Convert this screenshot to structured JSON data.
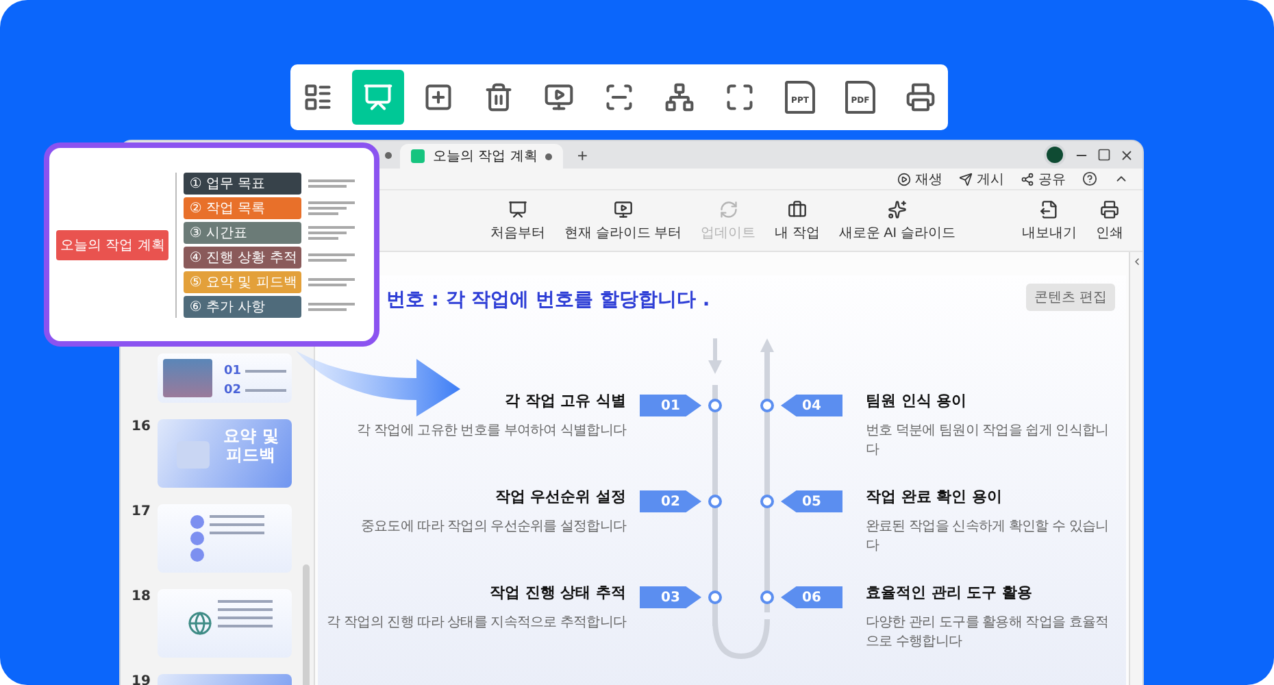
{
  "toolbar": {
    "buttons": [
      {
        "selected": false
      },
      {
        "selected": true
      },
      {
        "selected": false
      },
      {
        "selected": false
      },
      {
        "selected": false
      },
      {
        "selected": false
      },
      {
        "selected": false
      },
      {
        "selected": false
      },
      {
        "label": "PPT",
        "selected": false
      },
      {
        "label": "PDF",
        "selected": false
      },
      {
        "selected": false
      }
    ]
  },
  "mind_map": {
    "root": "오늘의 작업 계획",
    "branches": [
      {
        "label": "① 업무 목표",
        "color": "#37424a"
      },
      {
        "label": "② 작업 목록",
        "color": "#e8702a"
      },
      {
        "label": "③ 시간표",
        "color": "#6b7b77"
      },
      {
        "label": "④ 진행 상황 추적",
        "color": "#8a5a5a"
      },
      {
        "label": "⑤ 요약 및 피드백",
        "color": "#e3a03a"
      },
      {
        "label": "⑥ 추가 사항",
        "color": "#4f6b7b"
      }
    ]
  },
  "window": {
    "tabs": [
      {
        "label": "오늘의 작업 계획",
        "selected": true
      }
    ],
    "new_tab": "+",
    "actions": [
      "재생",
      "게시",
      "공유"
    ],
    "ribbon": [
      {
        "label": "처음부터",
        "disabled": false
      },
      {
        "label": "현재 슬라이드 부터",
        "disabled": false
      },
      {
        "label": "업데이트",
        "disabled": true
      },
      {
        "label": "내 작업",
        "disabled": false
      },
      {
        "label": "새로운 AI 슬라이드",
        "disabled": false
      }
    ],
    "ribbon_right": [
      "내보내기",
      "인쇄"
    ]
  },
  "slides_panel": {
    "thumbnails": [
      {
        "kind": "photo-list",
        "lines": [
          "01",
          "02"
        ]
      },
      {
        "kind": "title",
        "number": "16",
        "title": "요약 및 피드백"
      },
      {
        "kind": "list",
        "number": "17"
      },
      {
        "kind": "globe",
        "number": "18"
      },
      {
        "kind": "banner",
        "number": "19"
      }
    ]
  },
  "slide": {
    "title": "번호 : 각 작업에 번호를 할당합니다 .",
    "edit_button": "콘텐츠 편집",
    "left_items": [
      {
        "number": "01",
        "title": "각 작업 고유 식별",
        "description": "각 작업에 고유한 번호를 부여하여 식별합니다"
      },
      {
        "number": "02",
        "title": "작업 우선순위 설정",
        "description": "중요도에 따라 작업의 우선순위를 설정합니다"
      },
      {
        "number": "03",
        "title": "작업 진행 상태 추적",
        "description": "각 작업의 진행 따라 상태를 지속적으로 추적합니다"
      }
    ],
    "right_items": [
      {
        "number": "04",
        "title": "팀원 인식 용이",
        "description": "번호 덕분에 팀원이 작업을 쉽게 인식합니다"
      },
      {
        "number": "05",
        "title": "작업 완료 확인 용이",
        "description": "완료된 작업을 신속하게 확인할 수 있습니다"
      },
      {
        "number": "06",
        "title": "효율적인 관리 도구 활용",
        "description": "다양한 관리 도구를 활용해 작업을 효율적으로 수행합니다"
      }
    ]
  }
}
